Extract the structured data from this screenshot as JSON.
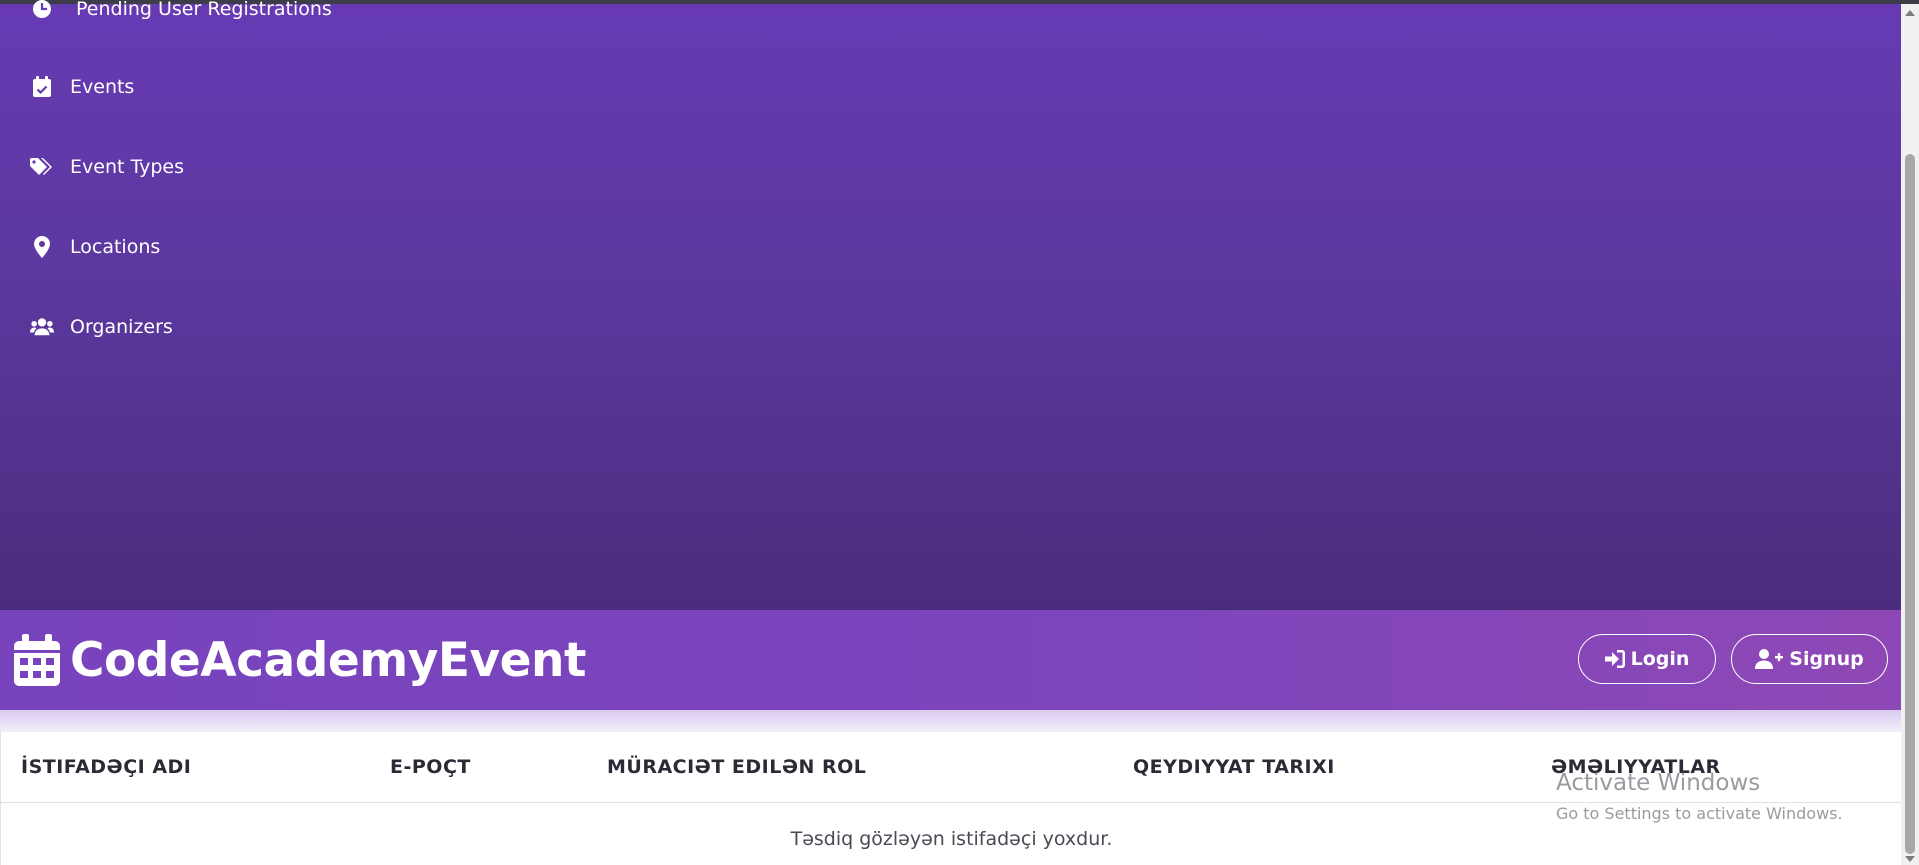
{
  "sidebar": {
    "items": [
      {
        "label": "Pending User Registrations",
        "icon": "clock-icon"
      },
      {
        "label": "Events",
        "icon": "calendar-check-icon"
      },
      {
        "label": "Event Types",
        "icon": "tags-icon"
      },
      {
        "label": "Locations",
        "icon": "map-pin-icon"
      },
      {
        "label": "Organizers",
        "icon": "users-icon"
      }
    ]
  },
  "header": {
    "brand": "CodeAcademyEvent",
    "login_label": "Login",
    "signup_label": "Signup"
  },
  "table": {
    "columns": [
      "İSTIFADƏÇI ADI",
      "E-POÇT",
      "MÜRACIƏT EDILƏN ROL",
      "QEYDIYYAT TARIXI",
      "ƏMƏLIYYATLAR"
    ],
    "empty_message": "Təsdiq gözləyən istifadəçi yoxdur."
  },
  "watermark": {
    "title": "Activate Windows",
    "subtitle": "Go to Settings to activate Windows."
  },
  "colors": {
    "sidebar_top": "#673ab4",
    "sidebar_bottom": "#4a2d7d",
    "header": "#7e45bc"
  }
}
